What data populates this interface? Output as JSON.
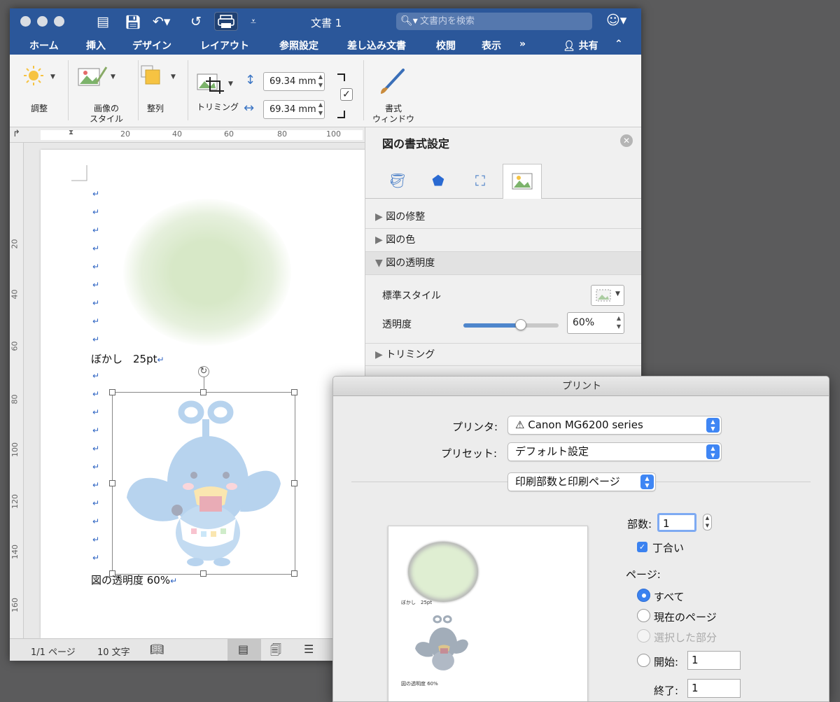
{
  "window": {
    "title": "文書 1",
    "search_placeholder": "文書内を検索"
  },
  "tabs": [
    "ホーム",
    "挿入",
    "デザイン",
    "レイアウト",
    "参照設定",
    "差し込み文書",
    "校閲",
    "表示"
  ],
  "tabs_more": "»",
  "share_label": "共有",
  "ribbon": {
    "adjust_label": "調整",
    "picture_style_label_1": "画像の",
    "picture_style_label_2": "スタイル",
    "arrange_label": "整列",
    "crop_label": "トリミング",
    "height_value": "69.34 mm",
    "width_value": "69.34 mm",
    "format_window_label_1": "書式",
    "format_window_label_2": "ウィンドウ"
  },
  "ruler": {
    "h_ticks": [
      "20",
      "40",
      "60",
      "80",
      "100"
    ],
    "v_ticks": [
      "20",
      "40",
      "60",
      "80",
      "100",
      "120",
      "140",
      "160"
    ]
  },
  "document": {
    "paragraph_mark": "↵",
    "blur_caption": "ぼかし　25pt",
    "transparency_caption": "図の透明度 60%"
  },
  "status": {
    "page": "1/1 ページ",
    "words": "10 文字"
  },
  "pane": {
    "title": "図の書式設定",
    "sections": {
      "correction": "図の修整",
      "color": "図の色",
      "transparency": "図の透明度",
      "crop": "トリミング"
    },
    "preset_label": "標準スタイル",
    "transparency_label": "透明度",
    "transparency_value": "60%",
    "transparency_level": 0.6
  },
  "print_dialog": {
    "title": "プリント",
    "printer_label": "プリンタ:",
    "printer_value": "⚠ Canon MG6200 series",
    "preset_label": "プリセット:",
    "preset_value": "デフォルト設定",
    "section_value": "印刷部数と印刷ページ",
    "copies_label": "部数:",
    "copies_value": "1",
    "collate_label": "丁合い",
    "pages_label": "ページ:",
    "radio_all": "すべて",
    "radio_current": "現在のページ",
    "radio_selection": "選択した部分",
    "from_label": "開始:",
    "from_value": "1",
    "to_label": "終了:",
    "to_value": "1",
    "preview_blur_caption": "ぼかし　25pt",
    "preview_transparency_caption": "図の透明度 60%"
  }
}
